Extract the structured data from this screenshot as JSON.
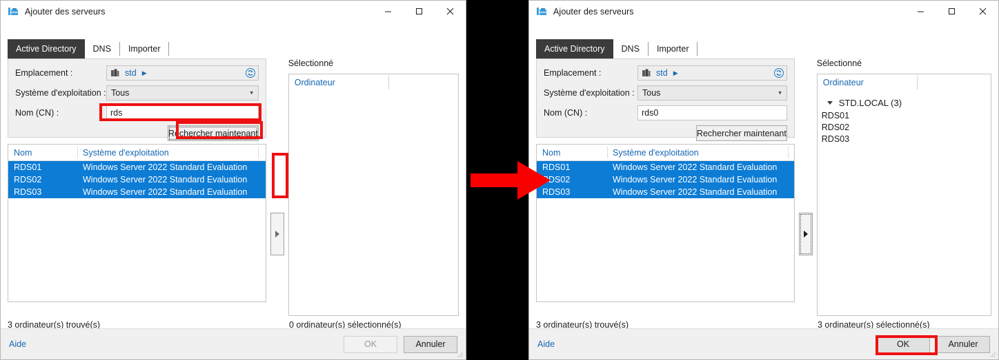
{
  "window_title": "Ajouter des serveurs",
  "window_controls": {
    "minimize": "minimize-icon",
    "maximize": "maximize-icon",
    "close": "close-icon"
  },
  "tabs": [
    {
      "label": "Active Directory",
      "active": true
    },
    {
      "label": "DNS",
      "active": false
    },
    {
      "label": "Importer",
      "active": false
    }
  ],
  "form": {
    "location_label": "Emplacement :",
    "location_value": "std",
    "refresh_icon": "refresh-icon",
    "os_label": "Système d'exploitation :",
    "os_value": "Tous",
    "name_label": "Nom (CN) :",
    "search_button": "Rechercher maintenant"
  },
  "left_window": {
    "name_value": "rds",
    "found_status": "3 ordinateur(s) trouvé(s)",
    "selected_status": "0 ordinateur(s) sélectionné(s)",
    "ok_enabled": false
  },
  "right_window": {
    "name_value": "rds0",
    "found_status": "3 ordinateur(s) trouvé(s)",
    "selected_status": "3 ordinateur(s) sélectionné(s)",
    "ok_enabled": true
  },
  "results": {
    "columns": [
      "Nom",
      "Système d'exploitation",
      ""
    ],
    "rows": [
      {
        "name": "RDS01",
        "os": "Windows Server 2022 Standard Evaluation",
        "selected": true
      },
      {
        "name": "RDS02",
        "os": "Windows Server 2022 Standard Evaluation",
        "selected": true
      },
      {
        "name": "RDS03",
        "os": "Windows Server 2022 Standard Evaluation",
        "selected": true
      }
    ]
  },
  "selected_panel": {
    "label": "Sélectionné",
    "column_header": "Ordinateur",
    "group": "STD.LOCAL (3)",
    "items": [
      "RDS01",
      "RDS02",
      "RDS03"
    ]
  },
  "footer": {
    "help": "Aide",
    "ok": "OK",
    "cancel": "Annuler"
  },
  "annotations": {
    "accent_red": "#ee1111",
    "selection_blue": "#0c7cd5",
    "link_blue": "#1667b3"
  }
}
